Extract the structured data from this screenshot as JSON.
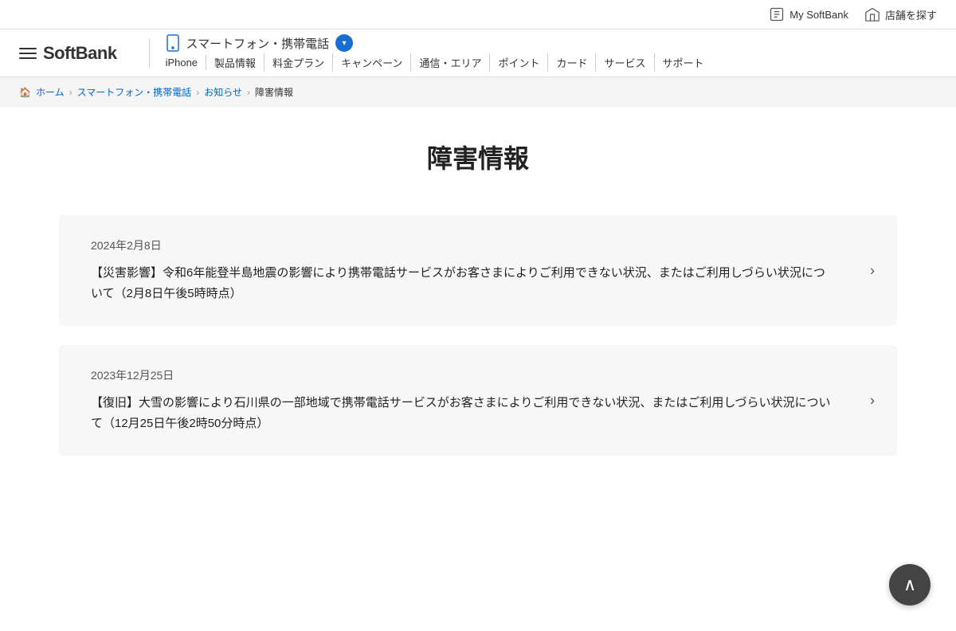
{
  "utility": {
    "my_softbank": "My SoftBank",
    "find_store": "店舗を探す"
  },
  "header": {
    "logo": "SoftBank",
    "category_label": "スマートフォン・携帯電話",
    "sub_nav": [
      {
        "id": "iphone",
        "label": "iPhone"
      },
      {
        "id": "products",
        "label": "製品情報"
      },
      {
        "id": "plans",
        "label": "料金プラン"
      },
      {
        "id": "campaigns",
        "label": "キャンペーン"
      },
      {
        "id": "network",
        "label": "通信・エリア"
      },
      {
        "id": "points",
        "label": "ポイント"
      },
      {
        "id": "card",
        "label": "カード"
      },
      {
        "id": "services",
        "label": "サービス"
      },
      {
        "id": "support",
        "label": "サポート"
      }
    ]
  },
  "breadcrumb": {
    "home": "ホーム",
    "category": "スマートフォン・携帯電話",
    "news": "お知らせ",
    "current": "障害情報"
  },
  "page": {
    "title": "障害情報"
  },
  "news_items": [
    {
      "date": "2024年2月8日",
      "title": "【災害影響】令和6年能登半島地震の影響により携帯電話サービスがお客さまによりご利用できない状況、またはご利用しづらい状況について（2月8日午後5時時点）"
    },
    {
      "date": "2023年12月25日",
      "title": "【復旧】大雪の影響により石川県の一部地域で携帯電話サービスがお客さまによりご利用できない状況、またはご利用しづらい状況について（12月25日午後2時50分時点）"
    }
  ]
}
